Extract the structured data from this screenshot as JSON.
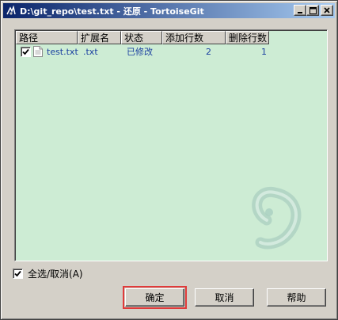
{
  "window": {
    "title": "D:\\git_repo\\test.txt - 还原 - TortoiseGit",
    "minimize_icon": "minimize-icon",
    "maximize_icon": "maximize-icon",
    "close_icon": "close-icon"
  },
  "list": {
    "columns": [
      "路径",
      "扩展名",
      "状态",
      "添加行数",
      "删除行数"
    ],
    "rows": [
      {
        "checked": true,
        "path": "test.txt",
        "ext": ".txt",
        "status": "已修改",
        "added": "2",
        "deleted": "1"
      }
    ],
    "text_color": "#1a3fa0",
    "background": "#cdecd4"
  },
  "select_all": {
    "label": "全选/取消(A)",
    "checked": true
  },
  "buttons": {
    "ok": "确定",
    "cancel": "取消",
    "help": "帮助"
  }
}
